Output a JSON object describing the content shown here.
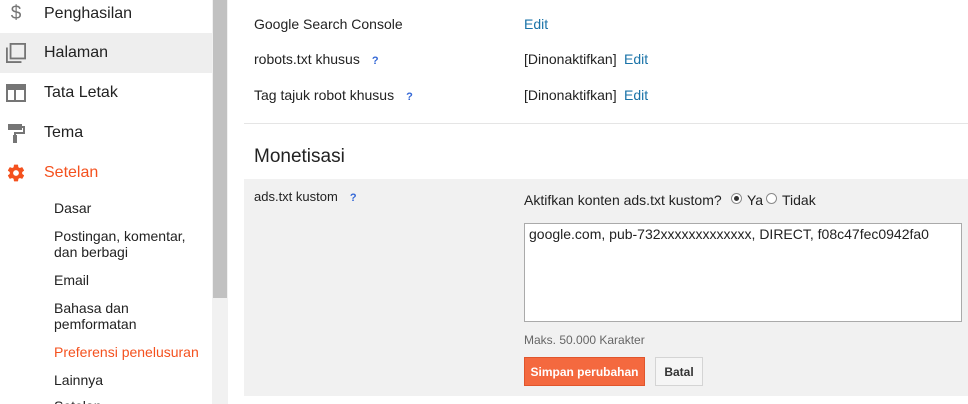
{
  "sidebar": {
    "items": [
      {
        "label": "Penghasilan",
        "icon": "dollar-icon"
      },
      {
        "label": "Halaman",
        "icon": "pages-icon"
      },
      {
        "label": "Tata Letak",
        "icon": "layout-icon"
      },
      {
        "label": "Tema",
        "icon": "paint-roller-icon"
      },
      {
        "label": "Setelan",
        "icon": "gear-icon"
      }
    ],
    "sub_items": [
      "Dasar",
      "Postingan, komentar, dan berbagi",
      "Email",
      "Bahasa dan pemformatan",
      "Preferensi penelusuran",
      "Lainnya"
    ],
    "partial_item": "Setelan"
  },
  "settings": {
    "search_console": {
      "label": "Google Search Console",
      "edit": "Edit"
    },
    "robots_txt": {
      "label": "robots.txt khusus",
      "help": "?",
      "value": "[Dinonaktifkan]",
      "edit": "Edit"
    },
    "robot_header_tags": {
      "label": "Tag tajuk robot khusus",
      "help": "?",
      "value": "[Dinonaktifkan]",
      "edit": "Edit"
    }
  },
  "monetization": {
    "title": "Monetisasi",
    "ads_txt_label": "ads.txt kustom",
    "help": "?",
    "question": "Aktifkan konten ads.txt kustom?",
    "option_yes": "Ya",
    "option_no": "Tidak",
    "selected": "Ya",
    "textarea_value": "google.com, pub-732xxxxxxxxxxxxx, DIRECT, f08c47fec0942fa0",
    "max_chars": "Maks. 50.000 Karakter",
    "save_label": "Simpan perubahan",
    "cancel_label": "Batal"
  },
  "colors": {
    "accent": "#f4511e",
    "link": "#1a73a8",
    "panel_bg": "#f1f1f1"
  }
}
